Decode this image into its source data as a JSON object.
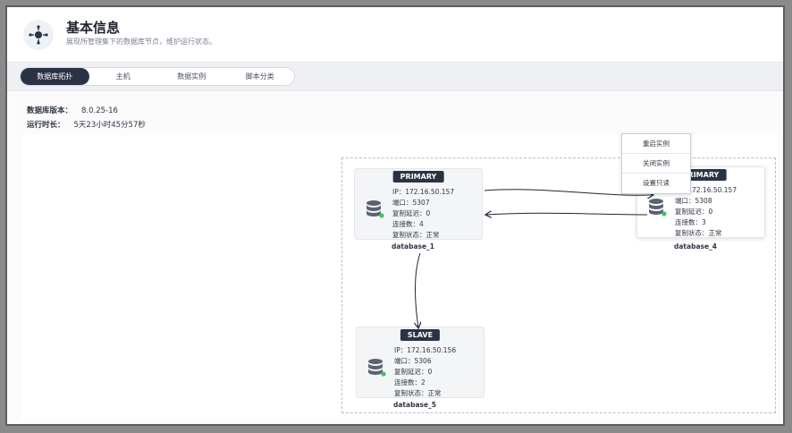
{
  "header": {
    "title": "基本信息",
    "subtitle": "展现所管理集下的数据库节点，维护运行状态。"
  },
  "tabs": [
    {
      "label": "数据库拓扑",
      "active": true
    },
    {
      "label": "主机",
      "active": false
    },
    {
      "label": "数据实例",
      "active": false
    },
    {
      "label": "脚本分类",
      "active": false
    }
  ],
  "info": {
    "version_label": "数据库版本：",
    "version_value": "8.0.25-16",
    "uptime_label": "运行时长：",
    "uptime_value": "5天23小时45分57秒"
  },
  "nodes": {
    "primary1": {
      "role": "PRIMARY",
      "ip": "IP：172.16.50.157",
      "port": "端口：5307",
      "delay": "复制延迟：0",
      "connections": "连接数：4",
      "status": "复制状态：正常",
      "name": "database_1"
    },
    "primary2": {
      "role": "PRIMARY",
      "ip": "IP：172.16.50.157",
      "port": "端口：5308",
      "delay": "复制延迟：0",
      "connections": "连接数：3",
      "status": "复制状态：正常",
      "name": "database_4"
    },
    "slave": {
      "role": "SLAVE",
      "ip": "IP：172.16.50.156",
      "port": "端口：5306",
      "delay": "复制延迟：0",
      "connections": "连接数：2",
      "status": "复制状态：正常",
      "name": "database_5"
    }
  },
  "context_menu": [
    "重启实例",
    "关闭实例",
    "设置只读"
  ],
  "colors": {
    "accent": "#2a3346",
    "status_ok": "#3cc46a",
    "db_icon": "#5a6272"
  }
}
